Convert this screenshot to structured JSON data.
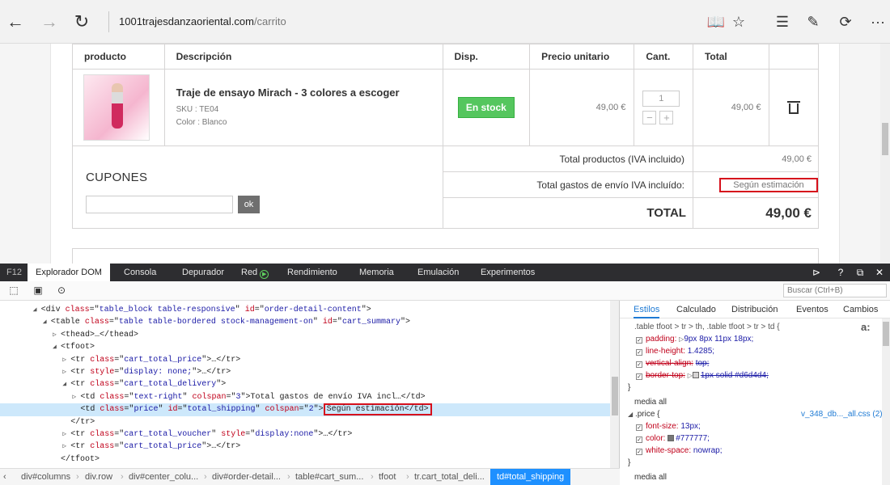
{
  "browser": {
    "url_host": "1001trajesdanzaoriental.com",
    "url_path": "/carrito"
  },
  "cart": {
    "headers": [
      "producto",
      "Descripción",
      "Disp.",
      "Precio unitario",
      "Cant.",
      "Total"
    ],
    "item": {
      "name": "Traje de ensayo Mirach - 3 colores a escoger",
      "sku": "SKU : TE04",
      "color": "Color : Blanco",
      "availability": "En stock",
      "unit_price": "49,00 €",
      "quantity": "1",
      "total": "49,00 €"
    },
    "totals": {
      "products_label": "Total productos (IVA incluido)",
      "products_value": "49,00 €",
      "shipping_label": "Total gastos de envío IVA incluído:",
      "shipping_value": "Según estimación",
      "total_label": "TOTAL",
      "total_value": "49,00 €"
    },
    "coupons": {
      "title": "CUPONES",
      "input_value": "",
      "button_label": "ok"
    }
  },
  "devtools": {
    "f12_label": "F12",
    "tabs": [
      "Explorador DOM",
      "Consola",
      "Depurador",
      "Red",
      "Rendimiento",
      "Memoria",
      "Emulación",
      "Experimentos"
    ],
    "active_tab": "Explorador DOM",
    "search_placeholder": "Buscar (Ctrl+B)",
    "dom_lines": [
      {
        "indent": 6,
        "tri": "◢",
        "parts": [
          [
            "tag",
            "<div "
          ],
          [
            "attr",
            "class"
          ],
          [
            "tag",
            "=\""
          ],
          [
            "val",
            "table_block table-responsive"
          ],
          [
            "tag",
            "\" "
          ],
          [
            "attr",
            "id"
          ],
          [
            "tag",
            "=\""
          ],
          [
            "val",
            "order-detail-content"
          ],
          [
            "tag",
            "\">"
          ]
        ]
      },
      {
        "indent": 8,
        "tri": "◢",
        "parts": [
          [
            "tag",
            "<table "
          ],
          [
            "attr",
            "class"
          ],
          [
            "tag",
            "=\""
          ],
          [
            "val",
            "table table-bordered stock-management-on"
          ],
          [
            "tag",
            "\" "
          ],
          [
            "attr",
            "id"
          ],
          [
            "tag",
            "=\""
          ],
          [
            "val",
            "cart_summary"
          ],
          [
            "tag",
            "\">"
          ]
        ]
      },
      {
        "indent": 10,
        "tri": "▷",
        "parts": [
          [
            "tag",
            "<thead>…</thead>"
          ]
        ]
      },
      {
        "indent": 10,
        "tri": "◢",
        "parts": [
          [
            "tag",
            "<tfoot>"
          ]
        ]
      },
      {
        "indent": 12,
        "tri": "▷",
        "parts": [
          [
            "tag",
            "<tr "
          ],
          [
            "attr",
            "class"
          ],
          [
            "tag",
            "=\""
          ],
          [
            "val",
            "cart_total_price"
          ],
          [
            "tag",
            "\">…</tr>"
          ]
        ]
      },
      {
        "indent": 12,
        "tri": "▷",
        "parts": [
          [
            "tag",
            "<tr "
          ],
          [
            "attr",
            "style"
          ],
          [
            "tag",
            "=\""
          ],
          [
            "val",
            "display: none;"
          ],
          [
            "tag",
            "\">…</tr>"
          ]
        ]
      },
      {
        "indent": 12,
        "tri": "◢",
        "parts": [
          [
            "tag",
            "<tr "
          ],
          [
            "attr",
            "class"
          ],
          [
            "tag",
            "=\""
          ],
          [
            "val",
            "cart_total_delivery"
          ],
          [
            "tag",
            "\">"
          ]
        ]
      },
      {
        "indent": 14,
        "tri": "▷",
        "parts": [
          [
            "tag",
            "<td "
          ],
          [
            "attr",
            "class"
          ],
          [
            "tag",
            "=\""
          ],
          [
            "val",
            "text-right"
          ],
          [
            "tag",
            "\" "
          ],
          [
            "attr",
            "colspan"
          ],
          [
            "tag",
            "=\""
          ],
          [
            "val",
            "3"
          ],
          [
            "tag",
            "\">"
          ],
          [
            "txt",
            "Total gastos de envío IVA incl…"
          ],
          [
            "tag",
            "</td>"
          ]
        ]
      },
      {
        "indent": 14,
        "tri": "",
        "selected": true,
        "parts": [
          [
            "tag",
            "<td "
          ],
          [
            "attr",
            "class"
          ],
          [
            "tag",
            "=\""
          ],
          [
            "val",
            "price"
          ],
          [
            "tag",
            "\" "
          ],
          [
            "attr",
            "id"
          ],
          [
            "tag",
            "=\""
          ],
          [
            "val",
            "total_shipping"
          ],
          [
            "tag",
            "\" "
          ],
          [
            "attr",
            "colspan"
          ],
          [
            "tag",
            "=\""
          ],
          [
            "val",
            "2"
          ],
          [
            "tag",
            "\">"
          ]
        ],
        "highlight": "Según estimación</td>"
      },
      {
        "indent": 12,
        "tri": "",
        "parts": [
          [
            "tag",
            "</tr>"
          ]
        ]
      },
      {
        "indent": 12,
        "tri": "▷",
        "parts": [
          [
            "tag",
            "<tr "
          ],
          [
            "attr",
            "class"
          ],
          [
            "tag",
            "=\""
          ],
          [
            "val",
            "cart_total_voucher"
          ],
          [
            "tag",
            "\" "
          ],
          [
            "attr",
            "style"
          ],
          [
            "tag",
            "=\""
          ],
          [
            "val",
            "display:none"
          ],
          [
            "tag",
            "\">…</tr>"
          ]
        ]
      },
      {
        "indent": 12,
        "tri": "▷",
        "parts": [
          [
            "tag",
            "<tr "
          ],
          [
            "attr",
            "class"
          ],
          [
            "tag",
            "=\""
          ],
          [
            "val",
            "cart_total_price"
          ],
          [
            "tag",
            "\">…</tr>"
          ]
        ]
      },
      {
        "indent": 10,
        "tri": "",
        "parts": [
          [
            "tag",
            "</tfoot>"
          ]
        ]
      }
    ],
    "breadcrumb": [
      "div#columns",
      "div.row",
      "div#center_colu...",
      "div#order-detail...",
      "table#cart_sum...",
      "tfoot",
      "tr.cart_total_deli...",
      "td#total_shipping"
    ],
    "styles_tabs": [
      "Estilos",
      "Calculado",
      "Distribución",
      "Eventos",
      "Cambios"
    ],
    "styles": {
      "selector1": ".table tfoot > tr > th, .table tfoot > tr > td  {",
      "padding_prop": "padding:",
      "padding_val": "9px 8px 11px 18px;",
      "lh_prop": "line-height:",
      "lh_val": "1.4285;",
      "va_prop": "vertical-align:",
      "va_val": "top;",
      "bt_prop": "border-top:",
      "bt_val": "1px solid #d6d4d4;",
      "close1": "}",
      "media1": "media all",
      "selector2": ".price  {",
      "source2": "v_348_db..._all.css (2)",
      "fs_prop": "font-size:",
      "fs_val": "13px;",
      "color_prop": "color:",
      "color_val": "#777777;",
      "ws_prop": "white-space:",
      "ws_val": "nowrap;",
      "close2": "}",
      "media2": "media all",
      "font_glyph": "a:"
    },
    "colors": {
      "accent": "#1e90ff",
      "highlight_box": "#d6101c",
      "stock_green": "#55c65e"
    }
  }
}
